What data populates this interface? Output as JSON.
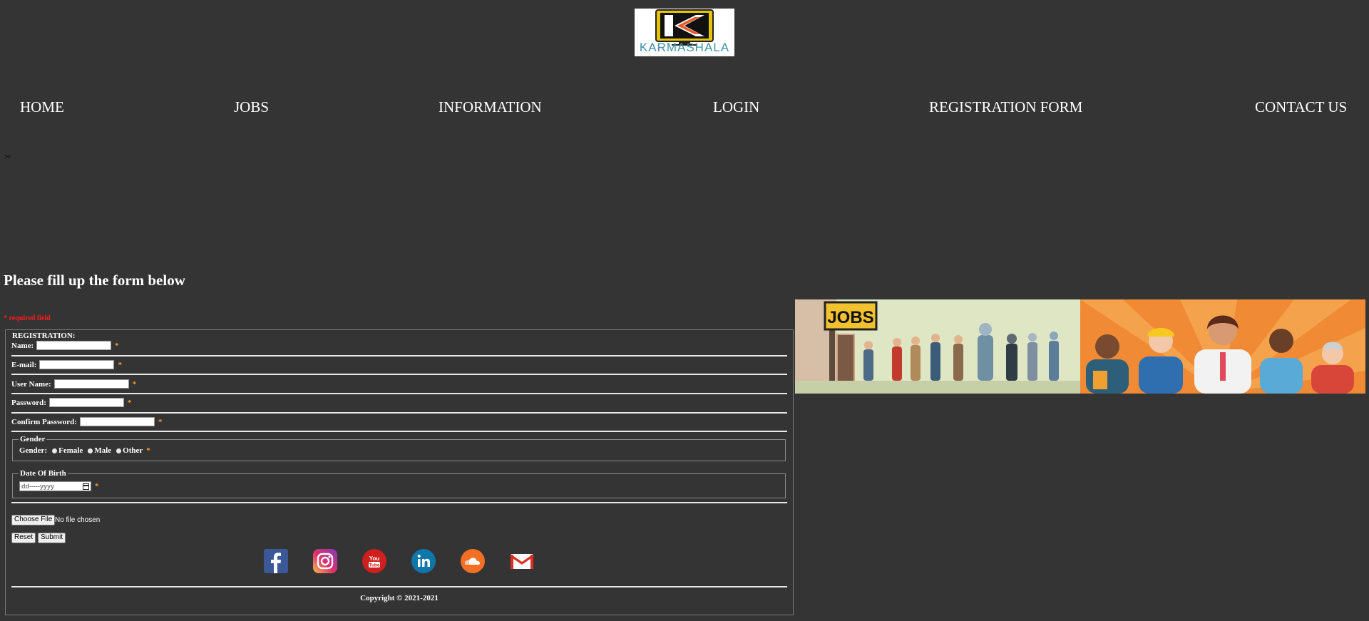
{
  "logo": {
    "text": "KARMASHALA"
  },
  "nav": [
    {
      "label": "HOME"
    },
    {
      "label": "JOBS"
    },
    {
      "label": "INFORMATION"
    },
    {
      "label": "LOGIN"
    },
    {
      "label": "REGISTRATION FORM"
    },
    {
      "label": "CONTACT US"
    }
  ],
  "heading": "Please fill up the form below",
  "required_note": "* required field",
  "form": {
    "legend": "REGISTRATION:",
    "name_label": "Name:",
    "email_label": "E-mail:",
    "username_label": "User Name:",
    "password_label": "Password:",
    "confirm_label": "Confirm Password:",
    "required_mark": "*",
    "gender": {
      "legend": "Gender",
      "label": "Gender:",
      "options": [
        "Female",
        "Male",
        "Other"
      ]
    },
    "dob": {
      "legend": "Date Of Birth",
      "placeholder": "dd-----yyyy"
    },
    "file_button": "Choose File",
    "file_status": "No file chosen",
    "reset_button": "Reset",
    "submit_button": "Submit"
  },
  "social": [
    "facebook-icon",
    "instagram-icon",
    "youtube-icon",
    "linkedin-icon",
    "soundcloud-icon",
    "gmail-icon"
  ],
  "banner": {
    "sign_text": "JOBS"
  },
  "footer": {
    "copyright": "Copyright © 2021-2021"
  },
  "colors": {
    "background": "#343434",
    "required": "#ff1a1a",
    "star": "#ff9a2e"
  }
}
